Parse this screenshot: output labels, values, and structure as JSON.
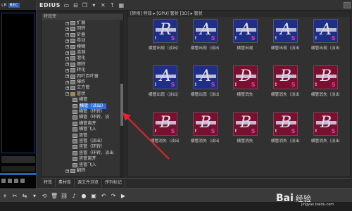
{
  "preview": {
    "label1": "LR",
    "rec": "REC"
  },
  "app": {
    "title": "EDIUS"
  },
  "tree": {
    "header": "特效夹",
    "items": [
      {
        "label": "扩展",
        "kind": "fx",
        "level": 1,
        "toggle": "+"
      },
      {
        "label": "回转",
        "kind": "fx",
        "level": 1,
        "toggle": "+"
      },
      {
        "label": "折叠",
        "kind": "fx",
        "level": 1,
        "toggle": "+"
      },
      {
        "label": "卷动",
        "kind": "fx",
        "level": 1,
        "toggle": "+"
      },
      {
        "label": "模糊",
        "kind": "fx",
        "level": 1,
        "toggle": "+"
      },
      {
        "label": "涟漪",
        "kind": "fx",
        "level": 1,
        "toggle": "+"
      },
      {
        "label": "溶化",
        "kind": "fx",
        "level": 1,
        "toggle": "+"
      },
      {
        "label": "擦除",
        "kind": "fx",
        "level": 1,
        "toggle": "+"
      },
      {
        "label": "转化",
        "kind": "fx",
        "level": 1,
        "toggle": "+"
      },
      {
        "label": "四叶百叶窗",
        "kind": "fx",
        "level": 1,
        "toggle": "+"
      },
      {
        "label": "爆炸",
        "kind": "fx",
        "level": 1,
        "toggle": "+"
      },
      {
        "label": "立方管",
        "kind": "fx",
        "level": 1,
        "toggle": "+"
      },
      {
        "label": "管状",
        "kind": "fold",
        "level": 1,
        "toggle": "−"
      },
      {
        "label": "横管",
        "kind": "fx",
        "level": 2,
        "toggle": ""
      },
      {
        "label": "横管（淡出）",
        "kind": "fx",
        "level": 2,
        "toggle": "",
        "selected": true
      },
      {
        "label": "横管（环转）",
        "kind": "fx",
        "level": 2,
        "toggle": ""
      },
      {
        "label": "横管（环转，淡",
        "kind": "fx",
        "level": 2,
        "toggle": ""
      },
      {
        "label": "横管离开",
        "kind": "fx",
        "level": 2,
        "toggle": ""
      },
      {
        "label": "横管飞入",
        "kind": "fx",
        "level": 2,
        "toggle": ""
      },
      {
        "label": "竖管",
        "kind": "fx",
        "level": 2,
        "toggle": ""
      },
      {
        "label": "竖管（淡出）",
        "kind": "fx",
        "level": 2,
        "toggle": ""
      },
      {
        "label": "竖管（环转）",
        "kind": "fx",
        "level": 2,
        "toggle": ""
      },
      {
        "label": "竖管（环转，淡出",
        "kind": "fx",
        "level": 2,
        "toggle": ""
      },
      {
        "label": "竖管离开",
        "kind": "fx",
        "level": 2,
        "toggle": ""
      },
      {
        "label": "竖管飞入",
        "kind": "fx",
        "level": 2,
        "toggle": ""
      },
      {
        "label": "翻转",
        "kind": "fx",
        "level": 1,
        "toggle": "+"
      }
    ]
  },
  "grid": {
    "path": "[转场] 特效 ▸ [GPU] 管状 [3D] ▸ 管状",
    "tiles": [
      {
        "caption": "横管出现（淡出）",
        "color": "a",
        "glyph": "R"
      },
      {
        "caption": "横管出现（淡出",
        "color": "a",
        "glyph": "A"
      },
      {
        "caption": "横管出现",
        "color": "a",
        "glyph": "A"
      },
      {
        "caption": "横管出现（淡出",
        "color": "a",
        "glyph": "A"
      },
      {
        "caption": "横管出现（淡出",
        "color": "a",
        "glyph": "A"
      },
      {
        "caption": "横管出现（淡出）",
        "color": "a",
        "glyph": "A"
      },
      {
        "caption": "横管出现（淡出",
        "color": "a",
        "glyph": "A"
      },
      {
        "caption": "横管消失",
        "color": "b",
        "glyph": "D"
      },
      {
        "caption": "横管消失（淡出",
        "color": "b",
        "glyph": "B"
      },
      {
        "caption": "横管消失（淡出",
        "color": "b",
        "glyph": "B"
      },
      {
        "caption": "横管消失（淡出",
        "color": "b",
        "glyph": "B"
      },
      {
        "caption": "横管消失（淡出",
        "color": "b",
        "glyph": "B"
      },
      {
        "caption": "横管消失",
        "color": "b",
        "glyph": "B"
      },
      {
        "caption": "横管消失（淡出",
        "color": "b",
        "glyph": "B"
      },
      {
        "caption": "横管消失（淡出",
        "color": "b",
        "glyph": "B"
      }
    ]
  },
  "tabs": [
    "特效",
    "素材库",
    "源文件浏览",
    "序列标记"
  ],
  "colors": {
    "accent": "#2f6fd6",
    "arrow": "#e8222a",
    "thumbBlue": "#1f2e86",
    "thumbRed": "#7a1030"
  },
  "watermark": {
    "logo": "Bai",
    "text": "经验",
    "url": "jingyan.baidu.com"
  }
}
